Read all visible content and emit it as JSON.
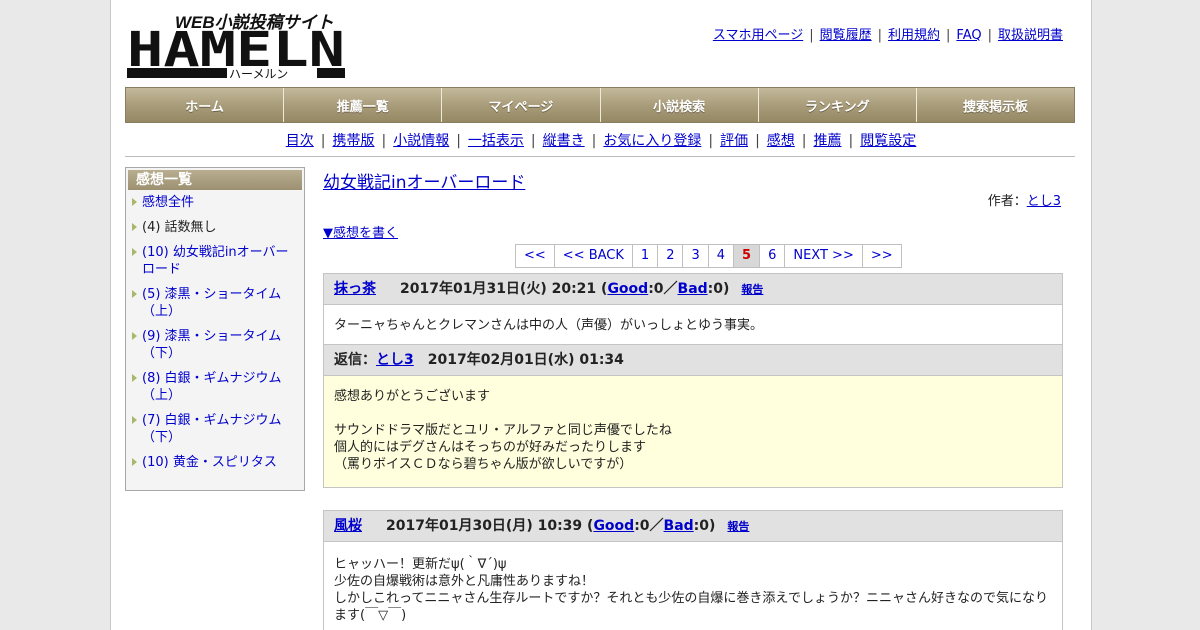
{
  "header": {
    "logo_tagline": "WEB小説投稿サイト",
    "logo_main": "HAMELN",
    "logo_kana": "ハーメルン",
    "links": [
      "スマホ用ページ",
      "閲覧履歴",
      "利用規約",
      "FAQ",
      "取扱説明書"
    ]
  },
  "mainnav": [
    "ホーム",
    "推薦一覧",
    "マイページ",
    "小説検索",
    "ランキング",
    "捜索掲示板"
  ],
  "subnav": [
    "目次",
    "携帯版",
    "小説情報",
    "一括表示",
    "縦書き",
    "お気に入り登録",
    "評価",
    "感想",
    "推薦",
    "閲覧設定"
  ],
  "sidebar": {
    "title": "感想一覧",
    "items": [
      {
        "label": "感想全件",
        "link": true
      },
      {
        "label": "(4) 話数無し",
        "link": false
      },
      {
        "label": "(10) 幼女戦記inオーバーロード",
        "link": true
      },
      {
        "label": "(5) 漆黒・ショータイム（上）",
        "link": true
      },
      {
        "label": "(9) 漆黒・ショータイム（下）",
        "link": true
      },
      {
        "label": "(8) 白銀・ギムナジウム（上）",
        "link": true
      },
      {
        "label": "(7) 白銀・ギムナジウム（下）",
        "link": true
      },
      {
        "label": "(10) 黄金・スピリタス",
        "link": true
      }
    ]
  },
  "content": {
    "novel_title": "幼女戦記inオーバーロード",
    "author_label": "作者：",
    "author_name": "とし3",
    "write_link": "▼感想を書く"
  },
  "pager": [
    "<<",
    "<< BACK",
    "1",
    "2",
    "3",
    "4",
    "5",
    "6",
    "NEXT >>",
    ">>"
  ],
  "pager_current": "5",
  "comments": [
    {
      "user": "抹っ茶",
      "date": "2017年01月31日(火) 20:21 (",
      "good_label": "Good",
      "good_count": ":0／",
      "bad_label": "Bad",
      "bad_count": ":0)",
      "report": "報告",
      "body": "ターニャちゃんとクレマンさんは中の人（声優）がいっしょとゆう事実。",
      "reply": {
        "label": "返信：",
        "user": "とし3",
        "date": "2017年02月01日(水) 01:34",
        "body": "感想ありがとうございます\n\nサウンドドラマ版だとユリ・アルファと同じ声優でしたね\n個人的にはデグさんはそっちのが好みだったりします\n（罵りボイスＣＤなら碧ちゃん版が欲しいですが）"
      }
    },
    {
      "user": "風桜",
      "date": "2017年01月30日(月) 10:39 (",
      "good_label": "Good",
      "good_count": ":0／",
      "bad_label": "Bad",
      "bad_count": ":0)",
      "report": "報告",
      "body": "ヒャッハー！更新だψ(｀∇´)ψ\n少佐の自爆戦術は意外と凡庸性ありますね！\nしかしこれってニニャさん生存ルートですか？それとも少佐の自爆に巻き添えでしょうか？ニニャさん好きなので気になります(￣▽￣)"
    }
  ]
}
